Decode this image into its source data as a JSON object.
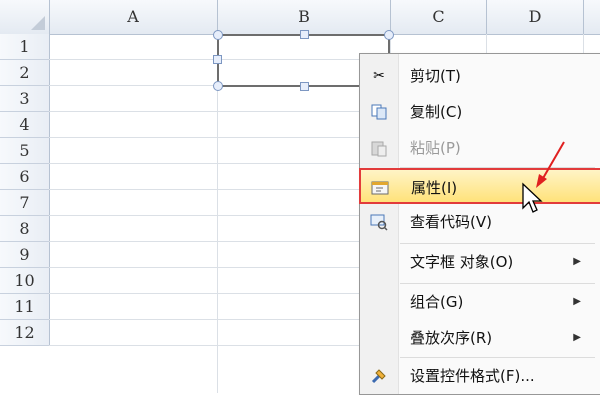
{
  "columns": [
    "A",
    "B",
    "C",
    "D"
  ],
  "rows": [
    "1",
    "2",
    "3",
    "4",
    "5",
    "6",
    "7",
    "8",
    "9",
    "10",
    "11",
    "12"
  ],
  "context_menu": {
    "items": [
      {
        "label": "剪切(T)",
        "icon": "scissors-icon",
        "enabled": true
      },
      {
        "label": "复制(C)",
        "icon": "copy-icon",
        "enabled": true
      },
      {
        "label": "粘贴(P)",
        "icon": "paste-icon",
        "enabled": false
      },
      {
        "label": "属性(I)",
        "icon": "properties-icon",
        "enabled": true,
        "highlighted": true
      },
      {
        "label": "查看代码(V)",
        "icon": "view-code-icon",
        "enabled": true
      },
      {
        "label": "文字框 对象(O)",
        "icon": "",
        "enabled": true,
        "submenu": true
      },
      {
        "label": "组合(G)",
        "icon": "",
        "enabled": true,
        "submenu": true
      },
      {
        "label": "叠放次序(R)",
        "icon": "",
        "enabled": true,
        "submenu": true
      },
      {
        "label": "设置控件格式(F)...",
        "icon": "format-control-icon",
        "enabled": true
      }
    ],
    "submenu_glyph": "▶"
  },
  "colors": {
    "highlight_border": "#e23b3b",
    "highlight_fill": "#ffe27a",
    "annotation_arrow": "#e02020"
  }
}
